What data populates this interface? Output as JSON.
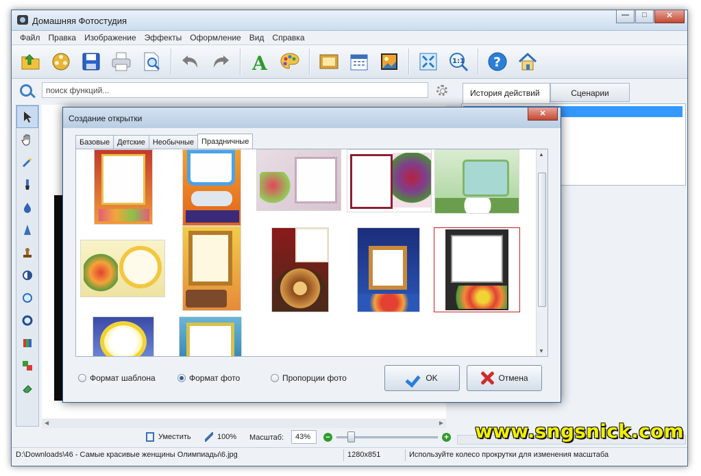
{
  "window": {
    "title": "Домашняя Фотостудия"
  },
  "menu": [
    "Файл",
    "Правка",
    "Изображение",
    "Эффекты",
    "Оформление",
    "Вид",
    "Справка"
  ],
  "toolbar": {
    "icons": [
      "open-folder-icon",
      "film-reel-icon",
      "save-disk-icon",
      "print-icon",
      "preview-icon",
      "undo-icon",
      "redo-icon",
      "text-tool-icon",
      "palette-icon",
      "frame-icon",
      "calendar-icon",
      "collage-icon",
      "fit-screen-icon",
      "actual-size-icon",
      "help-icon",
      "home-icon"
    ]
  },
  "search": {
    "placeholder": "поиск функций..."
  },
  "right_panel": {
    "tabs": [
      "История действий",
      "Сценарии"
    ]
  },
  "dialog": {
    "title": "Создание открытки",
    "close_glyph": "✕",
    "tabs": [
      "Базовые",
      "Детские",
      "Необычные",
      "Праздничные"
    ],
    "active_tab": "Праздничные",
    "options": [
      "Формат шаблона",
      "Формат фото",
      "Пропорции фото"
    ],
    "selected_option": "Формат фото",
    "ok_label": "OK",
    "cancel_label": "Отмена"
  },
  "zoom": {
    "fit_label": "Уместить",
    "zoom100_label": "100%",
    "scale_label": "Масштаб:",
    "scale_value": "43%"
  },
  "statusbar": {
    "path": "D:\\Downloads\\46 - Самые красивые женщины Олимпиады\\6.jpg",
    "dimensions": "1280x851",
    "hint": "Используйте колесо прокрутки для изменения масштаба"
  },
  "watermark": "www.sngsnick.com"
}
